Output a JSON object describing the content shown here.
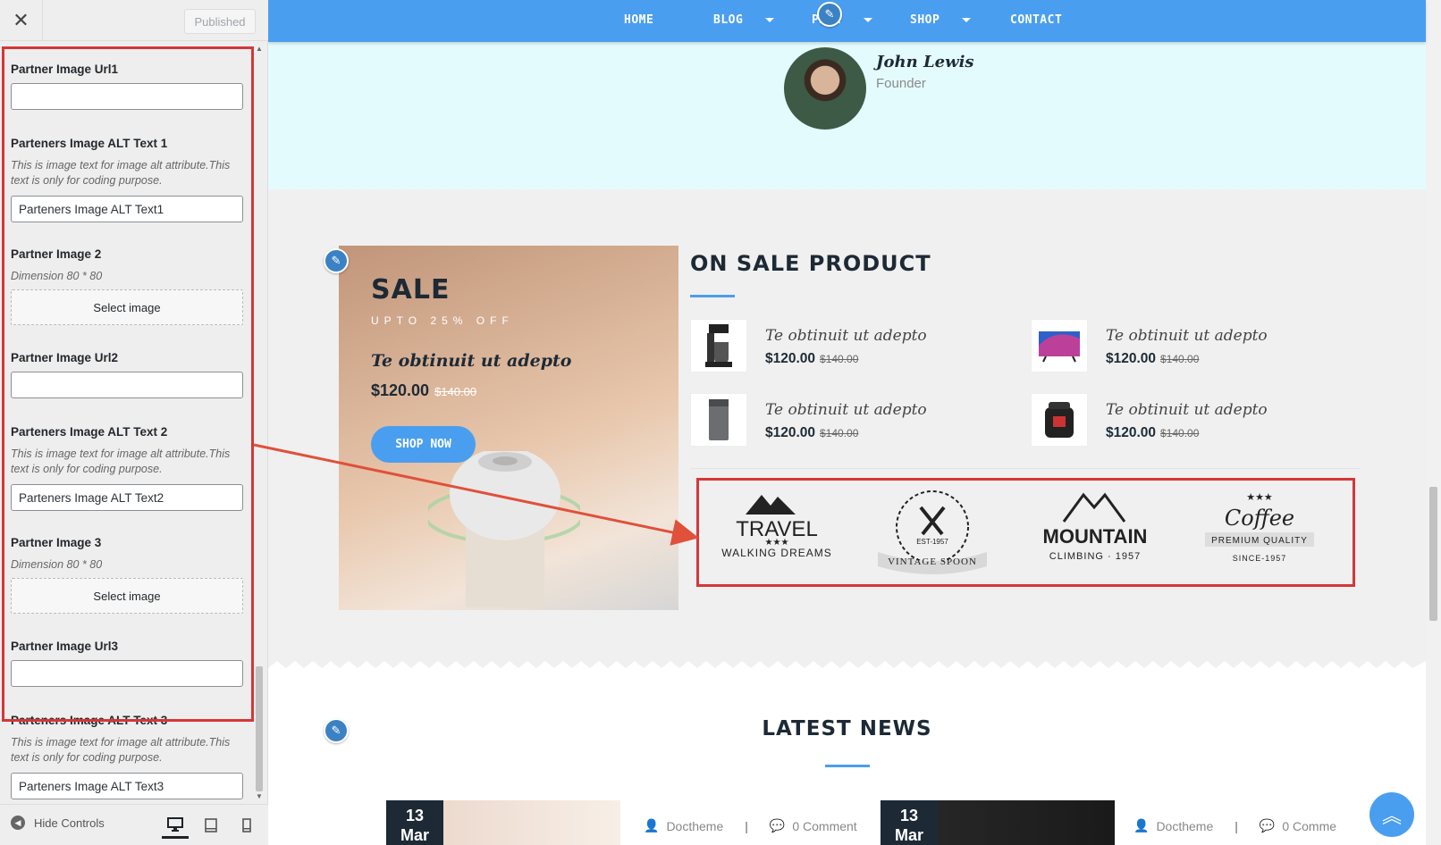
{
  "sidebar": {
    "close_icon": "close-icon",
    "published_label": "Published",
    "fields": [
      {
        "label": "Partner Image Url1",
        "type": "input",
        "value": ""
      },
      {
        "label": "Parteners Image ALT Text 1",
        "type": "input",
        "desc": "This is image text for image alt attribute.This text is only for coding purpose.",
        "value": "Parteners Image ALT Text1"
      },
      {
        "label": "Partner Image 2",
        "type": "image",
        "desc": "Dimension 80 * 80",
        "button": "Select image"
      },
      {
        "label": "Partner Image Url2",
        "type": "input",
        "value": ""
      },
      {
        "label": "Parteners Image ALT Text 2",
        "type": "input",
        "desc": "This is image text for image alt attribute.This text is only for coding purpose.",
        "value": "Parteners Image ALT Text2"
      },
      {
        "label": "Partner Image 3",
        "type": "image",
        "desc": "Dimension 80 * 80",
        "button": "Select image"
      },
      {
        "label": "Partner Image Url3",
        "type": "input",
        "value": ""
      },
      {
        "label": "Parteners Image ALT Text 3",
        "type": "input",
        "desc": "This is image text for image alt attribute.This text is only for coding purpose.",
        "value": "Parteners Image ALT Text3"
      }
    ],
    "footer": {
      "hide_controls": "Hide Controls",
      "devices": [
        "desktop-icon",
        "tablet-icon",
        "mobile-icon"
      ]
    }
  },
  "preview": {
    "nav": {
      "items": [
        "HOME",
        "BLOG",
        "PAGE",
        "SHOP",
        "CONTACT"
      ]
    },
    "team": {
      "name": "John Lewis",
      "role": "Founder"
    },
    "banner": {
      "sale": "SALE",
      "upto": "UPTO 25% OFF",
      "title": "Te obtinuit ut adepto",
      "price": "$120.00",
      "old_price": "$140.00",
      "button": "SHOP NOW"
    },
    "on_sale": {
      "title": "ON SALE PRODUCT",
      "products": [
        {
          "name": "Te obtinuit ut adepto",
          "price": "$120.00",
          "old_price": "$140.00",
          "icon": "coffee-maker-icon"
        },
        {
          "name": "Te obtinuit ut adepto",
          "price": "$120.00",
          "old_price": "$140.00",
          "icon": "tv-icon"
        },
        {
          "name": "Te obtinuit ut adepto",
          "price": "$120.00",
          "old_price": "$140.00",
          "icon": "trash-bin-icon"
        },
        {
          "name": "Te obtinuit ut adepto",
          "price": "$120.00",
          "old_price": "$140.00",
          "icon": "pressure-cooker-icon"
        }
      ]
    },
    "partners": [
      {
        "line1": "TRAVEL",
        "line2": "WALKING DREAMS"
      },
      {
        "line1": "EST-1957",
        "line2": "VINTAGE SPOON"
      },
      {
        "line1": "MOUNTAIN",
        "line2": "CLIMBING · 1957"
      },
      {
        "line1": "Coffee",
        "line2": "PREMIUM QUALITY",
        "line3": "SINCE-1957"
      }
    ],
    "news": {
      "title": "LATEST NEWS",
      "posts": [
        {
          "day": "13",
          "month": "Mar",
          "author": "Doctheme",
          "comments": "0 Comment"
        },
        {
          "day": "13",
          "month": "Mar",
          "author": "Doctheme",
          "comments": "0 Comme"
        }
      ]
    }
  },
  "colors": {
    "accent": "#4a9ef0",
    "highlight": "#d63638",
    "dark": "#1d2a35"
  }
}
